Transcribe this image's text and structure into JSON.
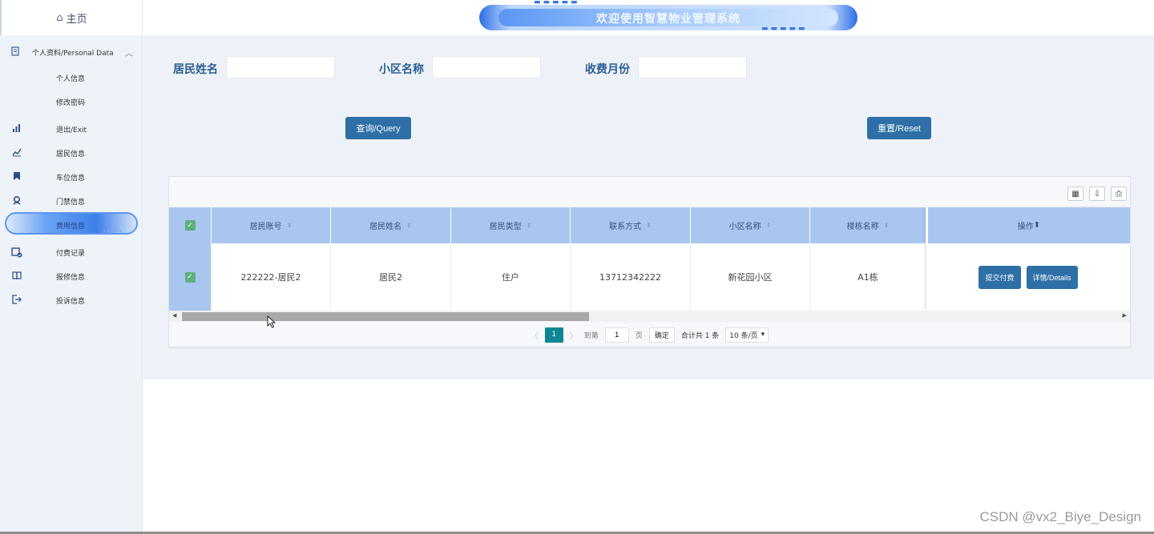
{
  "sidebar": {
    "home_label": "主页",
    "group_label": "个人资料/Personal Data",
    "items": [
      {
        "label": "个人信息",
        "icon": "none"
      },
      {
        "label": "修改密码",
        "icon": "none"
      },
      {
        "label": "退出/Exit",
        "icon": "bar-chart-icon"
      },
      {
        "label": "居民信息",
        "icon": "line-chart-icon"
      },
      {
        "label": "车位信息",
        "icon": "bookmark-icon"
      },
      {
        "label": "门禁信息",
        "icon": "user-badge-icon"
      },
      {
        "label": "费用信息",
        "icon": "none"
      },
      {
        "label": "付费记录",
        "icon": "calendar-check-icon"
      },
      {
        "label": "报修信息",
        "icon": "book-icon"
      },
      {
        "label": "投诉信息",
        "icon": "logout-icon"
      }
    ]
  },
  "header": {
    "title": "欢迎使用智慧物业管理系统"
  },
  "search": {
    "resident_name_label": "居民姓名",
    "community_name_label": "小区名称",
    "fee_month_label": "收费月份",
    "resident_name_value": "",
    "community_name_value": "",
    "fee_month_value": "",
    "query_button": "查询/Query",
    "reset_button": "重置/Reset"
  },
  "table": {
    "columns": [
      "居民账号",
      "居民姓名",
      "居民类型",
      "联系方式",
      "小区名称",
      "楼栋名称"
    ],
    "ops_header": "操作",
    "rows": [
      {
        "account": "222222-居民2",
        "name": "居民2",
        "type": "住户",
        "phone": "13712342222",
        "community": "新花园小区",
        "building": "A1栋",
        "submit_button": "提交付费",
        "details_button": "详情/Details"
      }
    ]
  },
  "pagination": {
    "current_page": "1",
    "goto_label": "到第",
    "goto_value": "1",
    "page_unit": "页",
    "confirm": "确定",
    "total": "合计共 1 条",
    "page_size": "10 条/页"
  },
  "watermark": "CSDN @vx2_Biye_Design",
  "colors": {
    "primary_button": "#2d6fa6",
    "table_header": "#a9c6ef",
    "label_blue": "#2b5d94",
    "pager_active": "#0d8794"
  }
}
